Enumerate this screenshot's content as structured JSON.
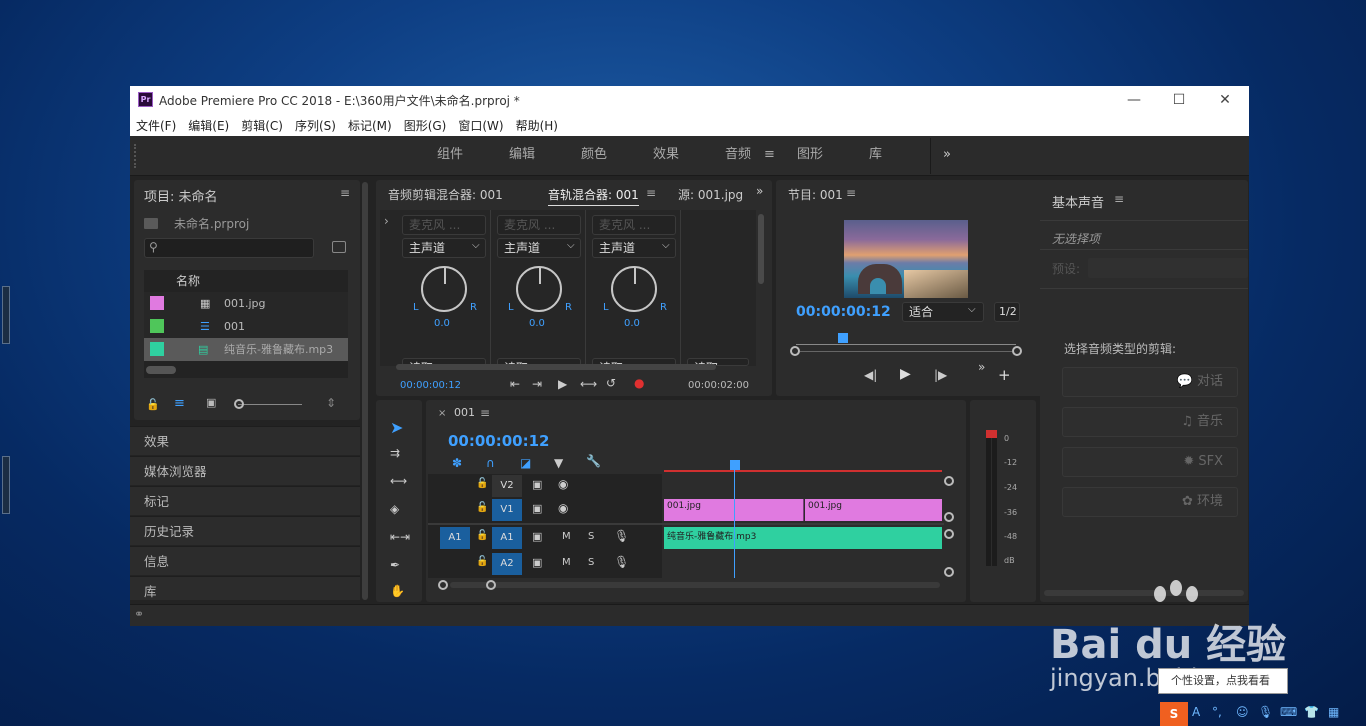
{
  "window": {
    "title": "Adobe Premiere Pro CC 2018 - E:\\360用户文件\\未命名.prproj *",
    "app_icon": "Pr"
  },
  "menu": [
    "文件(F)",
    "编辑(E)",
    "剪辑(C)",
    "序列(S)",
    "标记(M)",
    "图形(G)",
    "窗口(W)",
    "帮助(H)"
  ],
  "workspaces": {
    "tabs": [
      "组件",
      "编辑",
      "颜色",
      "效果",
      "音频",
      "图形",
      "库"
    ],
    "active": "音频"
  },
  "project": {
    "title": "项目: 未命名",
    "file": "未命名.prproj",
    "search_placeholder": "",
    "col_name": "名称",
    "items": [
      {
        "name": "001.jpg",
        "color": "#e07ae0"
      },
      {
        "name": "001",
        "color": "#4fc65a"
      },
      {
        "name": "纯音乐-雅鲁藏布.mp3",
        "color": "#2fd0a0"
      }
    ]
  },
  "side_panels": [
    "效果",
    "媒体浏览器",
    "标记",
    "历史记录",
    "信息",
    "库"
  ],
  "mixer": {
    "tabs": [
      "音频剪辑混合器: 001",
      "音轨混合器: 001",
      "源: 001.jpg"
    ],
    "input": "麦克风 ...",
    "output": "主声道",
    "value": "0.0",
    "l": "L",
    "r": "R",
    "read": "读取",
    "time_left": "00:00:00:12",
    "time_right": "00:00:02:00"
  },
  "program": {
    "title": "节目: 001",
    "timecode": "00:00:00:12",
    "fit": "适合",
    "ratio": "1/2"
  },
  "timeline": {
    "seq": "001",
    "timecode": "00:00:00:12",
    "tracks": [
      {
        "id": "V2"
      },
      {
        "id": "V1"
      },
      {
        "id": "A1",
        "src": "A1"
      },
      {
        "id": "A2"
      }
    ],
    "clips": {
      "v1a": "001.jpg",
      "v1b": "001.jpg",
      "a1": "纯音乐-雅鲁藏布.mp3"
    },
    "m": "M",
    "s": "S"
  },
  "meter": {
    "labels": [
      "0",
      "-12",
      "-24",
      "-36",
      "-48",
      "dB"
    ]
  },
  "essential": {
    "title": "基本声音",
    "none": "无选择项",
    "preset": "预设:",
    "prompt": "选择音频类型的剪辑:",
    "types": [
      "对话",
      "音乐",
      "SFX",
      "环境"
    ]
  },
  "watermark": {
    "brand": "Bai du 经验",
    "url": "jingyan.baidu.com",
    "tooltip": "个性设置，点我看看"
  }
}
